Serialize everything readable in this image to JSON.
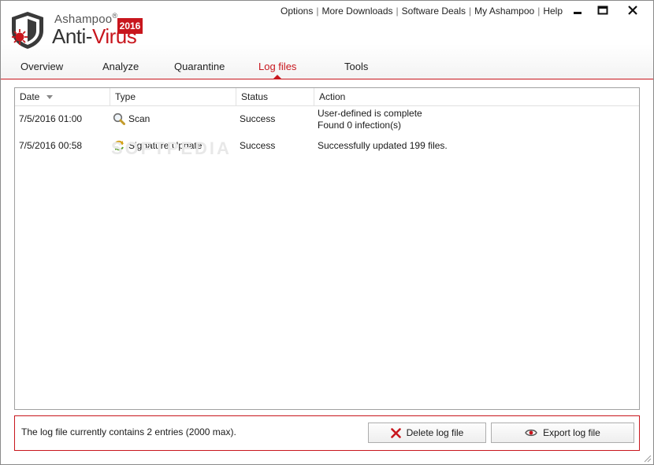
{
  "brand": {
    "vendor": "Ashampoo",
    "registered": "®",
    "product_prefix": "Anti-",
    "product_accent": "Virus",
    "year": "2016"
  },
  "toplinks": [
    "Options",
    "More Downloads",
    "Software Deals",
    "My Ashampoo",
    "Help"
  ],
  "separator": "|",
  "tabs": [
    "Overview",
    "Analyze",
    "Quarantine",
    "Log files",
    "Tools"
  ],
  "active_tab": "Log files",
  "table": {
    "columns": [
      "Date",
      "Type",
      "Status",
      "Action"
    ],
    "rows": [
      {
        "date": "7/5/2016 01:00",
        "type": "Scan",
        "icon": "magnifier-icon",
        "status": "Success",
        "action": [
          "User-defined is complete",
          "Found 0 infection(s)"
        ]
      },
      {
        "date": "7/5/2016 00:58",
        "type": "Signature Update",
        "icon": "refresh-icon",
        "status": "Success",
        "action": [
          "Successfully updated 199 files."
        ]
      }
    ]
  },
  "watermark": "SOFTPEDIA",
  "footer": {
    "summary": "The log file currently contains 2 entries (2000 max).",
    "delete_label": "Delete log file",
    "export_label": "Export log file"
  },
  "colors": {
    "accent": "#c8161d",
    "border": "#a0a0a0",
    "text": "#1a1a1a"
  }
}
